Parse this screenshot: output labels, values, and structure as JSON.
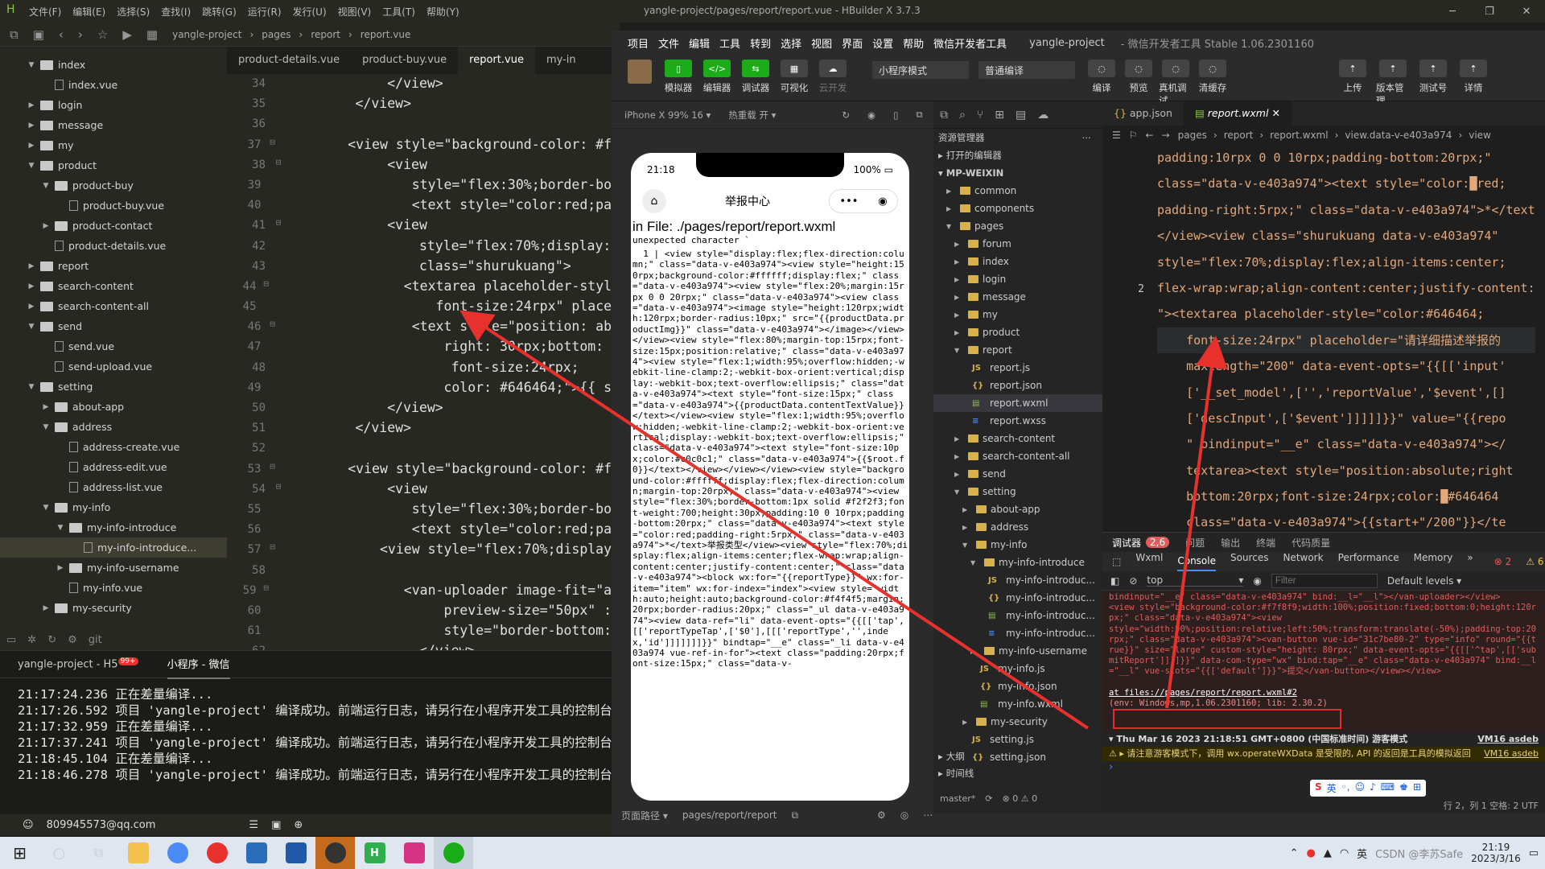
{
  "hbuilder": {
    "title": "yangle-project/pages/report/report.vue - HBuilder X 3.7.3",
    "menu": [
      "文件(F)",
      "编辑(E)",
      "选择(S)",
      "查找(I)",
      "跳转(G)",
      "运行(R)",
      "发行(U)",
      "视图(V)",
      "工具(T)",
      "帮助(Y)"
    ],
    "breadcrumb": [
      "yangle-project",
      "pages",
      "report",
      "report.vue"
    ],
    "tree": [
      {
        "label": "index",
        "depth": 1,
        "type": "folder",
        "open": true
      },
      {
        "label": "index.vue",
        "depth": 2,
        "type": "file"
      },
      {
        "label": "login",
        "depth": 1,
        "type": "folder"
      },
      {
        "label": "message",
        "depth": 1,
        "type": "folder"
      },
      {
        "label": "my",
        "depth": 1,
        "type": "folder"
      },
      {
        "label": "product",
        "depth": 1,
        "type": "folder",
        "open": true
      },
      {
        "label": "product-buy",
        "depth": 2,
        "type": "folder",
        "open": true
      },
      {
        "label": "product-buy.vue",
        "depth": 3,
        "type": "file"
      },
      {
        "label": "product-contact",
        "depth": 2,
        "type": "folder"
      },
      {
        "label": "product-details.vue",
        "depth": 2,
        "type": "file"
      },
      {
        "label": "report",
        "depth": 1,
        "type": "folder"
      },
      {
        "label": "search-content",
        "depth": 1,
        "type": "folder"
      },
      {
        "label": "search-content-all",
        "depth": 1,
        "type": "folder"
      },
      {
        "label": "send",
        "depth": 1,
        "type": "folder",
        "open": true
      },
      {
        "label": "send.vue",
        "depth": 2,
        "type": "file"
      },
      {
        "label": "send-upload.vue",
        "depth": 2,
        "type": "file"
      },
      {
        "label": "setting",
        "depth": 1,
        "type": "folder",
        "open": true
      },
      {
        "label": "about-app",
        "depth": 2,
        "type": "folder"
      },
      {
        "label": "address",
        "depth": 2,
        "type": "folder",
        "open": true
      },
      {
        "label": "address-create.vue",
        "depth": 3,
        "type": "file"
      },
      {
        "label": "address-edit.vue",
        "depth": 3,
        "type": "file"
      },
      {
        "label": "address-list.vue",
        "depth": 3,
        "type": "file"
      },
      {
        "label": "my-info",
        "depth": 2,
        "type": "folder",
        "open": true
      },
      {
        "label": "my-info-introduce",
        "depth": 3,
        "type": "folder",
        "open": true
      },
      {
        "label": "my-info-introduce...",
        "depth": 4,
        "type": "file",
        "selected": true
      },
      {
        "label": "my-info-username",
        "depth": 3,
        "type": "folder"
      },
      {
        "label": "my-info.vue",
        "depth": 3,
        "type": "file"
      },
      {
        "label": "my-security",
        "depth": 2,
        "type": "folder"
      }
    ],
    "tabs": [
      "product-details.vue",
      "product-buy.vue",
      "report.vue",
      "my-in"
    ],
    "active_tab": 2,
    "code": [
      {
        "n": "34",
        "f": "",
        "t": "            </view>"
      },
      {
        "n": "35",
        "f": "",
        "t": "        </view>"
      },
      {
        "n": "36",
        "f": "",
        "t": ""
      },
      {
        "n": "37",
        "f": "⊟",
        "t": "        <view style=\"background-color: #ff"
      },
      {
        "n": "38",
        "f": "⊟",
        "t": "            <view"
      },
      {
        "n": "39",
        "f": "",
        "t": "                style=\"flex:30%;border-bot"
      },
      {
        "n": "40",
        "f": "",
        "t": "                <text style=\"color:red;pad"
      },
      {
        "n": "41",
        "f": "⊟",
        "t": "            <view"
      },
      {
        "n": "42",
        "f": "",
        "t": "                style=\"flex:70%;display: "
      },
      {
        "n": "43",
        "f": "",
        "t": "                class=\"shurukuang\">"
      },
      {
        "n": "44",
        "f": "⊟",
        "t": "                <textarea placeholder-style"
      },
      {
        "n": "45",
        "f": "",
        "t": "                    font-size:24rpx\" placel"
      },
      {
        "n": "46",
        "f": "⊟",
        "t": "                <text style=\"position: abs"
      },
      {
        "n": "47",
        "f": "",
        "t": "                    right: 30rpx;bottom: 2"
      },
      {
        "n": "48",
        "f": "",
        "t": "                    font-size:24rpx;"
      },
      {
        "n": "49",
        "f": "",
        "t": "                    color: #646464;\">{{ st"
      },
      {
        "n": "50",
        "f": "",
        "t": "            </view>"
      },
      {
        "n": "51",
        "f": "",
        "t": "        </view>"
      },
      {
        "n": "52",
        "f": "",
        "t": ""
      },
      {
        "n": "53",
        "f": "⊟",
        "t": "        <view style=\"background-color: #ff"
      },
      {
        "n": "54",
        "f": "⊟",
        "t": "            <view"
      },
      {
        "n": "55",
        "f": "",
        "t": "                style=\"flex:30%;border-bot"
      },
      {
        "n": "56",
        "f": "",
        "t": "                <text style=\"color:red;pad"
      },
      {
        "n": "57",
        "f": "⊟",
        "t": "            <view style=\"flex:70%;display:"
      },
      {
        "n": "58",
        "f": "",
        "t": ""
      },
      {
        "n": "59",
        "f": "⊟",
        "t": "                <van-uploader image-fit=\"as"
      },
      {
        "n": "60",
        "f": "",
        "t": "                    preview-size=\"50px\" :a"
      },
      {
        "n": "61",
        "f": "",
        "t": "                    style=\"border-bottom: "
      },
      {
        "n": "62",
        "f": "",
        "t": "                </view>"
      }
    ],
    "console_tabs": [
      "yangle-project - H5",
      "小程序 - 微信"
    ],
    "h5_badge": "99+",
    "logs": [
      "21:17:24.236 正在差量编译...",
      "21:17:26.592 项目 'yangle-project' 编译成功。前端运行日志，请另行在小程序开发工具的控制台",
      "21:17:32.959 正在差量编译...",
      "21:17:37.241 项目 'yangle-project' 编译成功。前端运行日志，请另行在小程序开发工具的控制台",
      "21:18:45.104 正在差量编译...",
      "21:18:46.278 项目 'yangle-project' 编译成功。前端运行日志，请另行在小程序开发工具的控制台"
    ],
    "account": "809945573@qq.com"
  },
  "wechat": {
    "menu": [
      "项目",
      "文件",
      "编辑",
      "工具",
      "转到",
      "选择",
      "视图",
      "界面",
      "设置",
      "帮助",
      "微信开发者工具"
    ],
    "project": "yangle-project",
    "version": "- 微信开发者工具 Stable 1.06.2301160",
    "tools": [
      {
        "label": "模拟器",
        "icon": "▯",
        "on": true
      },
      {
        "label": "编辑器",
        "icon": "</>",
        "on": true
      },
      {
        "label": "调试器",
        "icon": "⇆",
        "on": true
      },
      {
        "label": "可视化",
        "icon": "▦",
        "on": false
      },
      {
        "label": "云开发",
        "icon": "☁",
        "on": false,
        "dim": true
      }
    ],
    "mode": "小程序模式",
    "compile": "普通编译",
    "actions": [
      "编译",
      "预览",
      "真机调试",
      "清缓存"
    ],
    "right_actions": [
      "上传",
      "版本管理",
      "测试号",
      "详情"
    ],
    "device": "iPhone X 99% 16 ▾",
    "hot": "热重载 开 ▾",
    "phone": {
      "time": "21:18",
      "battery": "100%",
      "title": "举报中心",
      "err_title": "in File: ./pages/report/report.wxml",
      "err_sub": " unexpected character `",
      "err_body": "  1 | <view style=\"display:flex;flex-direction:column;\" class=\"data-v-e403a974\"><view style=\"height:150rpx;background-color:#ffffff;display:flex;\" class=\"data-v-e403a974\"><view style=\"flex:20%;margin:15rpx 0 0 20rpx;\" class=\"data-v-e403a974\"><view class=\"data-v-e403a974\"><image style=\"height:120rpx;width:120rpx;border-radius:10px;\" src=\"{{productData.productImg}}\" class=\"data-v-e403a974\"></image></view></view><view style=\"flex:80%;margin-top:15rpx;font-size:15px;position:relative;\" class=\"data-v-e403a974\"><view style=\"flex:1;width:95%;overflow:hidden;-webkit-line-clamp:2;-webkit-box-orient:vertical;display:-webkit-box;text-overflow:ellipsis;\" class=\"data-v-e403a974\"><text style=\"font-size:15px;\" class=\"data-v-e403a974\">{{productData.contentTextValue}}</text></view><view style=\"flex:1;width:95%;overflow:hidden;-webkit-line-clamp:2;-webkit-box-orient:vertical;display:-webkit-box;text-overflow:ellipsis;\" class=\"data-v-e403a974\"><text style=\"font-size:10px;color:#c0c0c1;\" class=\"data-v-e403a974\">{{$root.f0}}</text></view></view></view><view style=\"background-color:#ffffff;display:flex;flex-direction:column;margin-top:20rpx;\" class=\"data-v-e403a974\"><view style=\"flex:30%;border-bottom:1px solid #f2f2f3;font-weight:700;height:30px;padding:10 0 10rpx;padding-bottom:20rpx;\" class=\"data-v-e403a974\"><text style=\"color:red;padding-right:5rpx;\" class=\"data-v-e403a974\">*</text>举报类型</view><view style=\"flex:70%;display:flex;align-items:center;flex-wrap:wrap;align-content:center;justify-content:center;\" class=\"data-v-e403a974\"><block wx:for=\"{{reportType}}\" wx:for-item=\"item\" wx:for-index=\"index\"><view style=\"width:auto;height:auto;background-color:#f4f4f5;margin:20rpx;border-radius:20px;\" class=\"_ul data-v-e403a974\"><view data-ref=\"li\" data-event-opts=\"{{[['tap',[['reportTypeTap',['$0'],[[['reportType','',index,'id']]]]]]]}}\" bindtap=\"__e\" class=\"_li data-v-e403a974 vue-ref-in-for\"><text class=\"padding:20rpx;font-size:15px;\" class=\"data-v-"
    },
    "sim_footer": [
      "页面路径 ▾",
      "pages/report/report"
    ],
    "explorer": {
      "title": "资源管理器",
      "open_editors": "打开的编辑器",
      "root": "MP-WEIXIN",
      "items": [
        {
          "label": "common",
          "depth": 1,
          "kind": "folder"
        },
        {
          "label": "components",
          "depth": 1,
          "kind": "folder"
        },
        {
          "label": "pages",
          "depth": 1,
          "kind": "folder-open"
        },
        {
          "label": "forum",
          "depth": 2,
          "kind": "folder"
        },
        {
          "label": "index",
          "depth": 2,
          "kind": "folder"
        },
        {
          "label": "login",
          "depth": 2,
          "kind": "folder"
        },
        {
          "label": "message",
          "depth": 2,
          "kind": "folder"
        },
        {
          "label": "my",
          "depth": 2,
          "kind": "folder"
        },
        {
          "label": "product",
          "depth": 2,
          "kind": "folder"
        },
        {
          "label": "report",
          "depth": 2,
          "kind": "folder-open"
        },
        {
          "label": "report.js",
          "depth": 3,
          "kind": "js"
        },
        {
          "label": "report.json",
          "depth": 3,
          "kind": "json"
        },
        {
          "label": "report.wxml",
          "depth": 3,
          "kind": "wxml",
          "selected": true
        },
        {
          "label": "report.wxss",
          "depth": 3,
          "kind": "wxss"
        },
        {
          "label": "search-content",
          "depth": 2,
          "kind": "folder"
        },
        {
          "label": "search-content-all",
          "depth": 2,
          "kind": "folder"
        },
        {
          "label": "send",
          "depth": 2,
          "kind": "folder"
        },
        {
          "label": "setting",
          "depth": 2,
          "kind": "folder-open"
        },
        {
          "label": "about-app",
          "depth": 3,
          "kind": "folder"
        },
        {
          "label": "address",
          "depth": 3,
          "kind": "folder"
        },
        {
          "label": "my-info",
          "depth": 3,
          "kind": "folder-open"
        },
        {
          "label": "my-info-introduce",
          "depth": 4,
          "kind": "folder-open"
        },
        {
          "label": "my-info-introduc...",
          "depth": 5,
          "kind": "js"
        },
        {
          "label": "my-info-introduc...",
          "depth": 5,
          "kind": "json"
        },
        {
          "label": "my-info-introduc...",
          "depth": 5,
          "kind": "wxml"
        },
        {
          "label": "my-info-introduc...",
          "depth": 5,
          "kind": "wxss"
        },
        {
          "label": "my-info-username",
          "depth": 4,
          "kind": "folder"
        },
        {
          "label": "my-info.js",
          "depth": 4,
          "kind": "js"
        },
        {
          "label": "my-info.json",
          "depth": 4,
          "kind": "json"
        },
        {
          "label": "my-info.wxml",
          "depth": 4,
          "kind": "wxml"
        },
        {
          "label": "my-security",
          "depth": 3,
          "kind": "folder"
        },
        {
          "label": "setting.js",
          "depth": 3,
          "kind": "js"
        },
        {
          "label": "setting.json",
          "depth": 3,
          "kind": "json"
        }
      ],
      "outline": "大纲",
      "timeline": "时间线",
      "branch": "master*",
      "problems": "⊗ 0 ⚠ 0"
    },
    "code_tabs": [
      "app.json",
      "report.wxml"
    ],
    "code_crumb": [
      "pages",
      "report",
      "report.wxml",
      "view.data-v-e403a974",
      "view"
    ],
    "code_line_no": "2",
    "code": [
      {
        "t": "padding:10rpx 0 0 10rpx;padding-bottom:20rpx;\"",
        "c": "o"
      },
      {
        "t": "class=\"data-v-e403a974\"><text style=\"color:█red;",
        "c": "o"
      },
      {
        "t": "padding-right:5rpx;\" class=\"data-v-e403a974\">*</text",
        "c": "o"
      },
      {
        "t": "</view><view class=\"shurukuang data-v-e403a974\"",
        "c": "o"
      },
      {
        "t": "style=\"flex:70%;display:flex;align-items:center;",
        "c": "o"
      },
      {
        "t": "flex-wrap:wrap;align-content:center;justify-content:",
        "c": "o"
      },
      {
        "t": "\"><textarea placeholder-style=\"color:#646464;",
        "c": "o"
      },
      {
        "t": "    font-size:24rpx\" placeholder=\"请详细描述举报的",
        "c": "hl"
      },
      {
        "t": "    maxlength=\"200\" data-event-opts=\"{{[['input'",
        "c": "o"
      },
      {
        "t": "    ['__set_model',['','reportValue','$event',[]",
        "c": "o"
      },
      {
        "t": "    ['descInput',['$event']]]]]}}\" value=\"{{repo",
        "c": "o"
      },
      {
        "t": "    \" bindinput=\"__e\" class=\"data-v-e403a974\"></",
        "c": "o"
      },
      {
        "t": "    textarea><text style=\"position:absolute;right",
        "c": "o"
      },
      {
        "t": "    bottom:20rpx;font-size:24rpx;color:█#646464",
        "c": "o"
      },
      {
        "t": "    class=\"data-v-e403a974\">{{start+\"/200\"}}</te",
        "c": "o"
      }
    ],
    "debug_tabs": [
      "调试器",
      "2,6",
      "问题",
      "输出",
      "终端",
      "代码质量"
    ],
    "devtools_tabs": [
      "Wxml",
      "Console",
      "Sources",
      "Network",
      "Performance",
      "Memory",
      "»"
    ],
    "err_count": "2",
    "warn_count": "6",
    "context": "top",
    "filter_placeholder": "Filter",
    "levels": "Default levels ▾",
    "console_log": "bindinput=\"__e\" class=\"data-v-e403a974\" bind:__l=\"__l\"></van-uploader></view>\n<view style=\"background-color:#f7f8f9;width:100%;position:fixed;bottom:0;height:120rpx;\" class=\"data-v-e403a974\"><view\nstyle=\"width:90%;position:relative;left:50%;transform:translate(-50%);padding-top:20rpx;\" class=\"data-v-e403a974\"><van-button vue-id=\"31c7be80-2\" type=\"info\" round=\"{{true}}\" size=\"large\" custom-style=\"height: 80rpx;\" data-event-opts=\"{{[['^tap',[['submitReport']]]]}}\" data-com-type=\"wx\" bind:tap=\"__e\" class=\"data-v-e403a974\" bind:__l=\"__l\" vue-slots=\"{{['default']}}\">提交</van-button></view></view>",
    "err_at": "at files://pages/report/report.wxml#2",
    "err_env": "(env: Windows,mp,1.06.2301160; lib: 2.30.2)",
    "warn_time": "Thu Mar 16 2023 21:18:51 GMT+0800 (中国标准时间) 游客模式",
    "warn_time_link": "VM16 asdeb",
    "warn_msg": "请注意游客模式下，调用 wx.operateWXData 是受限的, API 的返回是工具的模拟返回",
    "warn_link": "VM16 asdeb",
    "status_right": "行 2，列 1    空格: 2    UTF"
  },
  "taskbar": {
    "time": "21:19",
    "date": "2023/3/16",
    "ime": "英",
    "watermark": "CSDN @李苏Safe"
  },
  "colors": {
    "arrow": "#e8312c",
    "green": "#1aad19",
    "err_red": "#e35b5b"
  }
}
